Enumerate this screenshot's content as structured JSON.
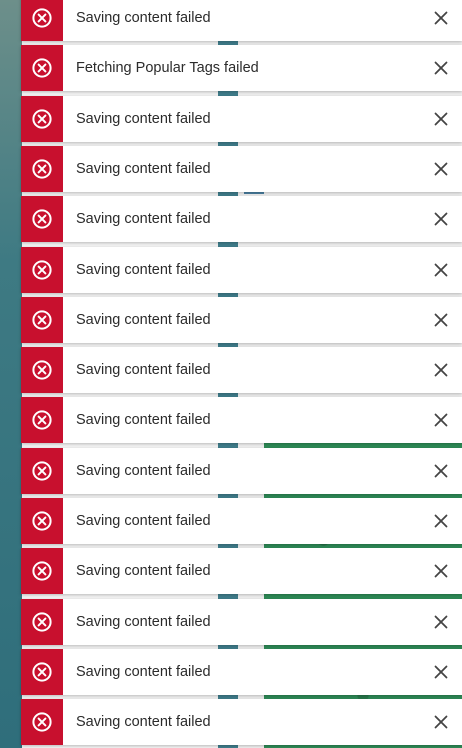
{
  "colors": {
    "error_accent": "#c8102e",
    "toast_background": "#ffffff",
    "message_text": "#2b2b2b",
    "close_icon": "#444444"
  },
  "toast_icon": "error-circle-x-icon",
  "close_icon_name": "close-icon",
  "toasts": [
    {
      "message": "Saving content failed"
    },
    {
      "message": "Fetching Popular Tags failed"
    },
    {
      "message": "Saving content failed"
    },
    {
      "message": "Saving content failed"
    },
    {
      "message": "Saving content failed"
    },
    {
      "message": "Saving content failed"
    },
    {
      "message": "Saving content failed"
    },
    {
      "message": "Saving content failed"
    },
    {
      "message": "Saving content failed"
    },
    {
      "message": "Saving content failed"
    },
    {
      "message": "Saving content failed"
    },
    {
      "message": "Saving content failed"
    },
    {
      "message": "Saving content failed"
    },
    {
      "message": "Saving content failed"
    },
    {
      "message": "Saving content failed"
    }
  ]
}
